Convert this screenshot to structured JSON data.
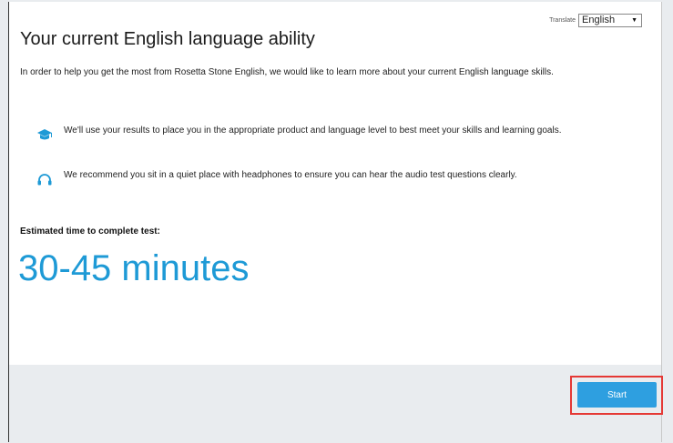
{
  "translate": {
    "label": "Translate",
    "selected": "English",
    "arrow_icon": "chevron-down-icon"
  },
  "page": {
    "title": "Your current English language ability",
    "intro": "In order to help you get the most from Rosetta Stone English, we would like to learn more about your current English language skills."
  },
  "bullets": [
    {
      "icon": "graduation-cap-icon",
      "text": "We'll use your results to place you in the appropriate product and language level to best meet your skills and learning goals."
    },
    {
      "icon": "headphones-icon",
      "text": "We recommend you sit in a quiet place with headphones to ensure you can hear the audio test questions clearly."
    }
  ],
  "estimate": {
    "label": "Estimated time to complete test:",
    "value": "30-45 minutes"
  },
  "footer": {
    "start_label": "Start"
  },
  "colors": {
    "accent": "#1e9ad6",
    "button": "#2e9fe0",
    "highlight": "#e53935",
    "footer_bg": "#e9ecef"
  }
}
